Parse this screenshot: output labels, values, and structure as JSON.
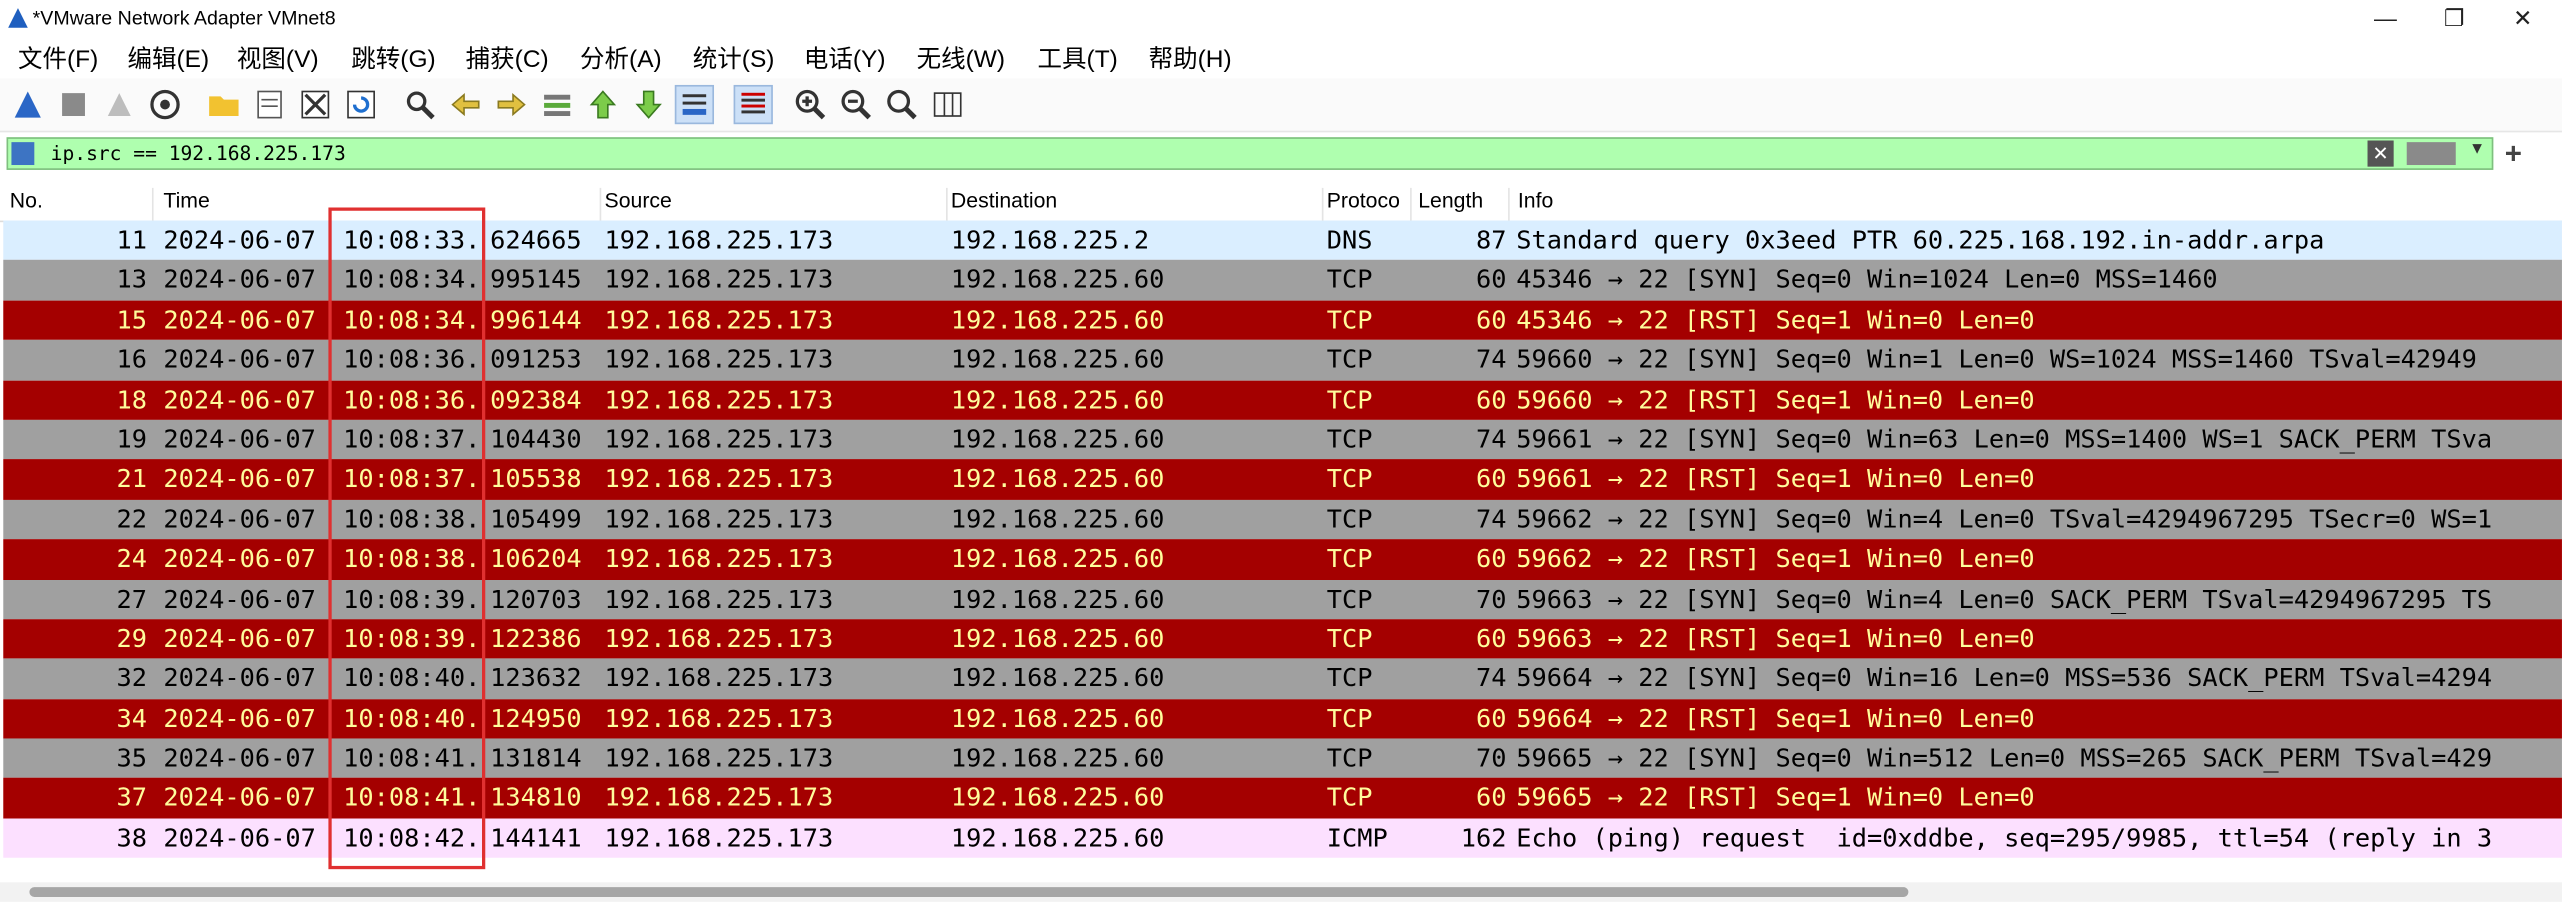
{
  "window": {
    "title": "*VMware Network Adapter VMnet8",
    "minimize": "—",
    "restore": "❐",
    "close": "✕"
  },
  "menu": [
    "文件(F)",
    "编辑(E)",
    "视图(V)",
    "跳转(G)",
    "捕获(C)",
    "分析(A)",
    "统计(S)",
    "电话(Y)",
    "无线(W)",
    "工具(T)",
    "帮助(H)"
  ],
  "toolbar_icons": [
    "shark-fin-start-icon",
    "stop-icon",
    "restart-icon",
    "capture-options-icon",
    "open-folder-icon",
    "save-file-icon",
    "close-file-icon",
    "reload-icon",
    "find-icon",
    "back-icon",
    "forward-icon",
    "go-to-packet-icon",
    "first-packet-icon",
    "last-packet-icon",
    "autoscroll-icon",
    "colorize-icon",
    "zoom-in-icon",
    "zoom-out-icon",
    "normal-size-icon",
    "resize-columns-icon"
  ],
  "filter": {
    "text": "ip.src == 192.168.225.173",
    "plus": "+"
  },
  "columns": {
    "no": "No.",
    "time": "Time",
    "source": "Source",
    "destination": "Destination",
    "protocol": "Protoco",
    "length": "Length",
    "info": "Info"
  },
  "colors": {
    "dns_bg": "#daeeff",
    "syn_bg": "#a0a0a0",
    "rst_bg": "#a40000",
    "rst_fg": "#fffc9c",
    "icmp_bg": "#fce0ff",
    "highlight_box": "#e03030"
  },
  "rows": [
    {
      "no": "11",
      "date": "2024-06-07",
      "time_a": "10:08:33.",
      "time_b": "624665",
      "src": "192.168.225.173",
      "dst": "192.168.225.2",
      "proto": "DNS",
      "len": "87",
      "info": "Standard query 0x3eed PTR 60.225.168.192.in-addr.arpa",
      "kind": "dns"
    },
    {
      "no": "13",
      "date": "2024-06-07",
      "time_a": "10:08:34.",
      "time_b": "995145",
      "src": "192.168.225.173",
      "dst": "192.168.225.60",
      "proto": "TCP",
      "len": "60",
      "info": "45346 → 22 [SYN] Seq=0 Win=1024 Len=0 MSS=1460",
      "kind": "syn"
    },
    {
      "no": "15",
      "date": "2024-06-07",
      "time_a": "10:08:34.",
      "time_b": "996144",
      "src": "192.168.225.173",
      "dst": "192.168.225.60",
      "proto": "TCP",
      "len": "60",
      "info": "45346 → 22 [RST] Seq=1 Win=0 Len=0",
      "kind": "rst"
    },
    {
      "no": "16",
      "date": "2024-06-07",
      "time_a": "10:08:36.",
      "time_b": "091253",
      "src": "192.168.225.173",
      "dst": "192.168.225.60",
      "proto": "TCP",
      "len": "74",
      "info": "59660 → 22 [SYN] Seq=0 Win=1 Len=0 WS=1024 MSS=1460 TSval=42949",
      "kind": "syn"
    },
    {
      "no": "18",
      "date": "2024-06-07",
      "time_a": "10:08:36.",
      "time_b": "092384",
      "src": "192.168.225.173",
      "dst": "192.168.225.60",
      "proto": "TCP",
      "len": "60",
      "info": "59660 → 22 [RST] Seq=1 Win=0 Len=0",
      "kind": "rst"
    },
    {
      "no": "19",
      "date": "2024-06-07",
      "time_a": "10:08:37.",
      "time_b": "104430",
      "src": "192.168.225.173",
      "dst": "192.168.225.60",
      "proto": "TCP",
      "len": "74",
      "info": "59661 → 22 [SYN] Seq=0 Win=63 Len=0 MSS=1400 WS=1 SACK_PERM TSva",
      "kind": "syn"
    },
    {
      "no": "21",
      "date": "2024-06-07",
      "time_a": "10:08:37.",
      "time_b": "105538",
      "src": "192.168.225.173",
      "dst": "192.168.225.60",
      "proto": "TCP",
      "len": "60",
      "info": "59661 → 22 [RST] Seq=1 Win=0 Len=0",
      "kind": "rst"
    },
    {
      "no": "22",
      "date": "2024-06-07",
      "time_a": "10:08:38.",
      "time_b": "105499",
      "src": "192.168.225.173",
      "dst": "192.168.225.60",
      "proto": "TCP",
      "len": "74",
      "info": "59662 → 22 [SYN] Seq=0 Win=4 Len=0 TSval=4294967295 TSecr=0 WS=1",
      "kind": "syn"
    },
    {
      "no": "24",
      "date": "2024-06-07",
      "time_a": "10:08:38.",
      "time_b": "106204",
      "src": "192.168.225.173",
      "dst": "192.168.225.60",
      "proto": "TCP",
      "len": "60",
      "info": "59662 → 22 [RST] Seq=1 Win=0 Len=0",
      "kind": "rst"
    },
    {
      "no": "27",
      "date": "2024-06-07",
      "time_a": "10:08:39.",
      "time_b": "120703",
      "src": "192.168.225.173",
      "dst": "192.168.225.60",
      "proto": "TCP",
      "len": "70",
      "info": "59663 → 22 [SYN] Seq=0 Win=4 Len=0 SACK_PERM TSval=4294967295 TS",
      "kind": "syn"
    },
    {
      "no": "29",
      "date": "2024-06-07",
      "time_a": "10:08:39.",
      "time_b": "122386",
      "src": "192.168.225.173",
      "dst": "192.168.225.60",
      "proto": "TCP",
      "len": "60",
      "info": "59663 → 22 [RST] Seq=1 Win=0 Len=0",
      "kind": "rst"
    },
    {
      "no": "32",
      "date": "2024-06-07",
      "time_a": "10:08:40.",
      "time_b": "123632",
      "src": "192.168.225.173",
      "dst": "192.168.225.60",
      "proto": "TCP",
      "len": "74",
      "info": "59664 → 22 [SYN] Seq=0 Win=16 Len=0 MSS=536 SACK_PERM TSval=4294",
      "kind": "syn"
    },
    {
      "no": "34",
      "date": "2024-06-07",
      "time_a": "10:08:40.",
      "time_b": "124950",
      "src": "192.168.225.173",
      "dst": "192.168.225.60",
      "proto": "TCP",
      "len": "60",
      "info": "59664 → 22 [RST] Seq=1 Win=0 Len=0",
      "kind": "rst"
    },
    {
      "no": "35",
      "date": "2024-06-07",
      "time_a": "10:08:41.",
      "time_b": "131814",
      "src": "192.168.225.173",
      "dst": "192.168.225.60",
      "proto": "TCP",
      "len": "70",
      "info": "59665 → 22 [SYN] Seq=0 Win=512 Len=0 MSS=265 SACK_PERM TSval=429",
      "kind": "syn"
    },
    {
      "no": "37",
      "date": "2024-06-07",
      "time_a": "10:08:41.",
      "time_b": "134810",
      "src": "192.168.225.173",
      "dst": "192.168.225.60",
      "proto": "TCP",
      "len": "60",
      "info": "59665 → 22 [RST] Seq=1 Win=0 Len=0",
      "kind": "rst"
    },
    {
      "no": "38",
      "date": "2024-06-07",
      "time_a": "10:08:42.",
      "time_b": "144141",
      "src": "192.168.225.173",
      "dst": "192.168.225.60",
      "proto": "ICMP",
      "len": "162",
      "info": "Echo (ping) request  id=0xddbe, seq=295/9985, ttl=54 (reply in 3",
      "kind": "icmp"
    }
  ]
}
